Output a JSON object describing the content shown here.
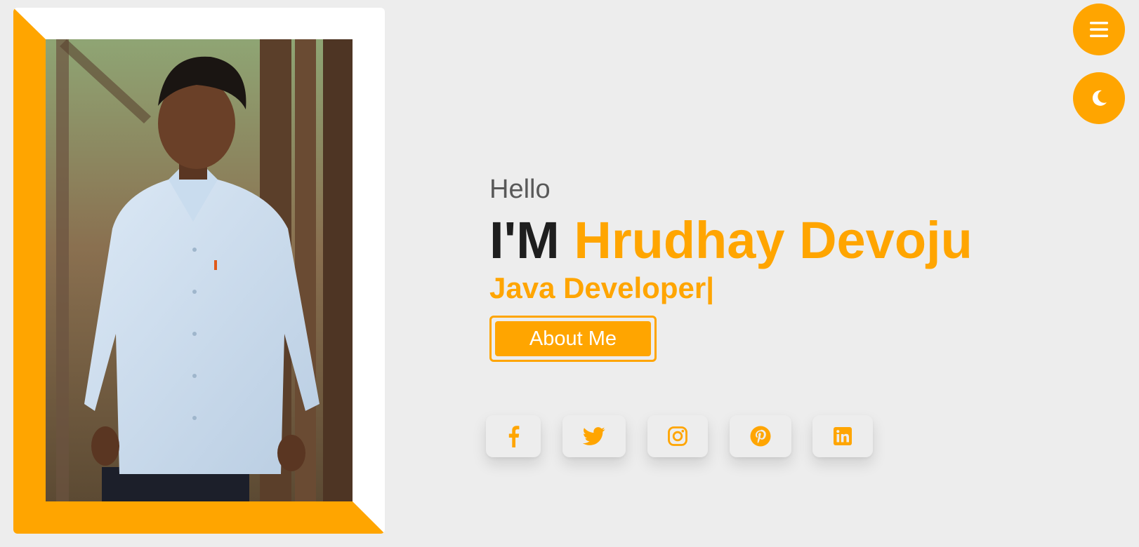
{
  "hero": {
    "greeting": "Hello",
    "prefix": "I'M",
    "name": "Hrudhay Devoju",
    "role": "Java Developer|",
    "about_label": "About Me"
  },
  "social": [
    {
      "icon": "facebook-icon"
    },
    {
      "icon": "twitter-icon"
    },
    {
      "icon": "instagram-icon"
    },
    {
      "icon": "pinterest-icon"
    },
    {
      "icon": "linkedin-icon"
    }
  ],
  "controls": {
    "menu_icon": "hamburger-menu-icon",
    "theme_icon": "moon-icon"
  },
  "colors": {
    "accent": "#ffa500",
    "background": "#ededed",
    "text_dark": "#1e1e1e",
    "text_muted": "#595959"
  }
}
